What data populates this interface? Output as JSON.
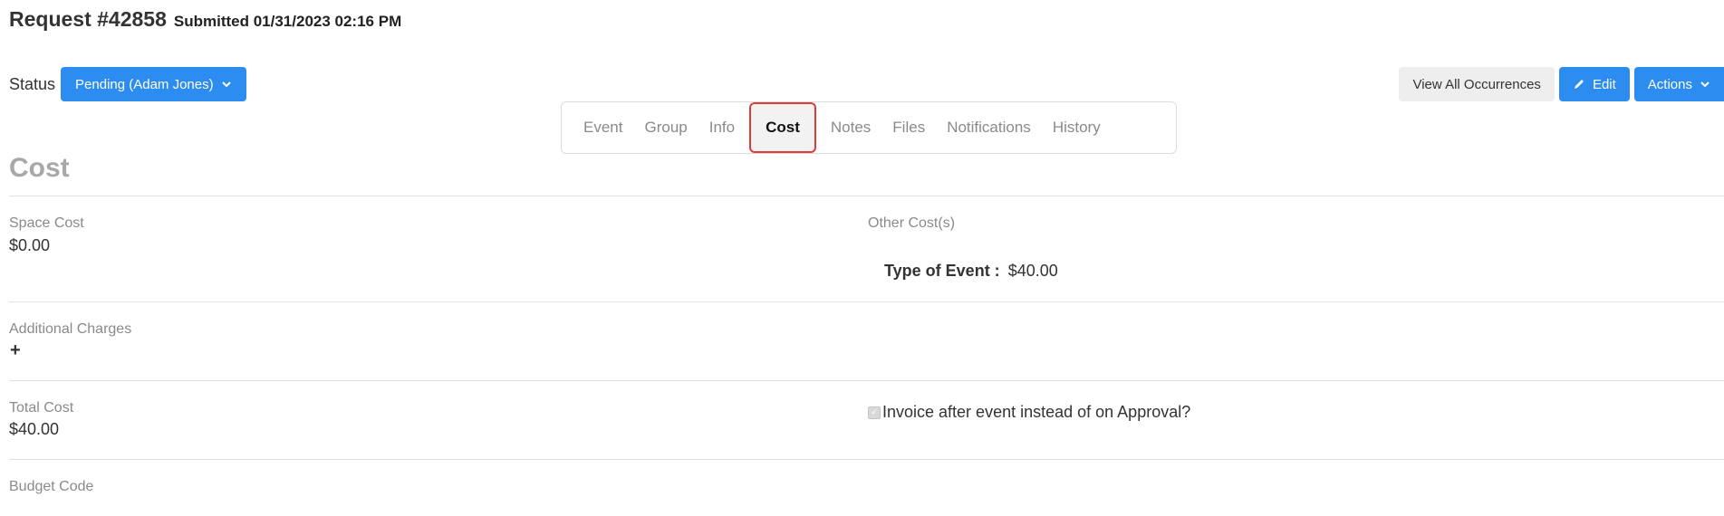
{
  "header": {
    "title": "Request #42858",
    "submitted": "Submitted 01/31/2023 02:16 PM"
  },
  "status": {
    "label": "Status",
    "value": "Pending (Adam Jones)"
  },
  "actions": {
    "view_all": "View All Occurrences",
    "edit": "Edit",
    "actions": "Actions"
  },
  "tabs": [
    {
      "label": "Event"
    },
    {
      "label": "Group"
    },
    {
      "label": "Info"
    },
    {
      "label": "Cost",
      "active": true
    },
    {
      "label": "Notes"
    },
    {
      "label": "Files"
    },
    {
      "label": "Notifications"
    },
    {
      "label": "History"
    }
  ],
  "section": {
    "title": "Cost"
  },
  "fields": {
    "space_cost": {
      "label": "Space Cost",
      "value": "$0.00"
    },
    "other_costs": {
      "label": "Other Cost(s)",
      "type_label": "Type of Event :",
      "type_value": "$40.00"
    },
    "additional_charges": {
      "label": "Additional Charges",
      "add": "+"
    },
    "total_cost": {
      "label": "Total Cost",
      "value": "$40.00"
    },
    "invoice": {
      "label": "Invoice after event instead of on Approval?",
      "checked": true
    },
    "budget_code": {
      "label": "Budget Code"
    }
  },
  "colors": {
    "primary": "#2d8cf0",
    "highlight": "#e03a3a"
  }
}
